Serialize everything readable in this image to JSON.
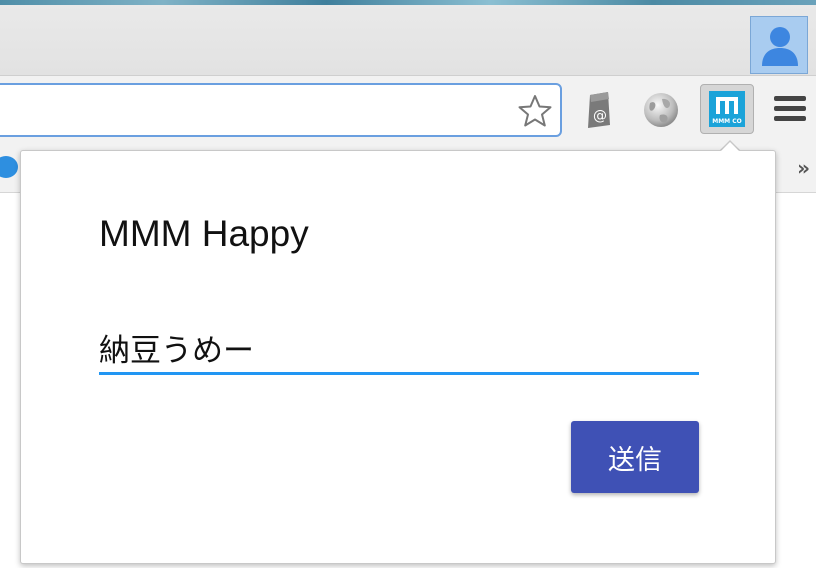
{
  "popup": {
    "title": "MMM Happy",
    "input_value": "納豆うめー",
    "submit_label": "送信"
  },
  "toolbar": {
    "extensions": [
      {
        "icon": "at-sign-icon"
      },
      {
        "icon": "globe-icon"
      },
      {
        "icon": "mmm-co-icon",
        "label": "MMM CO"
      }
    ]
  },
  "bookmarks": {
    "overflow_label": "»"
  },
  "colors": {
    "accent_blue": "#2196f3",
    "button_indigo": "#3f51b5",
    "profile_blue": "#a9ccf0"
  }
}
